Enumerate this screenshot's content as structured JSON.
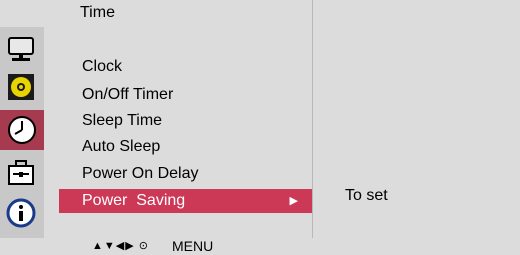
{
  "header": {
    "title": "Time"
  },
  "sidebar": {
    "icons": [
      {
        "name": "monitor-icon"
      },
      {
        "name": "audio-disc-icon"
      },
      {
        "name": "clock-icon",
        "active": true
      },
      {
        "name": "toolbox-icon"
      },
      {
        "name": "info-icon"
      }
    ]
  },
  "menu": {
    "items": [
      {
        "label": "Clock"
      },
      {
        "label": "On/Off Timer"
      },
      {
        "label": "Sleep Time"
      },
      {
        "label": "Auto Sleep"
      },
      {
        "label": "Power On Delay"
      },
      {
        "label": "Power  Saving",
        "selected": true
      }
    ]
  },
  "panel": {
    "value_text": "To set"
  },
  "footer": {
    "nav_glyphs": "▲▼◀▶ ⊙",
    "menu_label": "MENU"
  },
  "colors": {
    "selection": "#cc3957",
    "active_icon_bg": "#a63a4e",
    "background": "#dcdcdc"
  }
}
